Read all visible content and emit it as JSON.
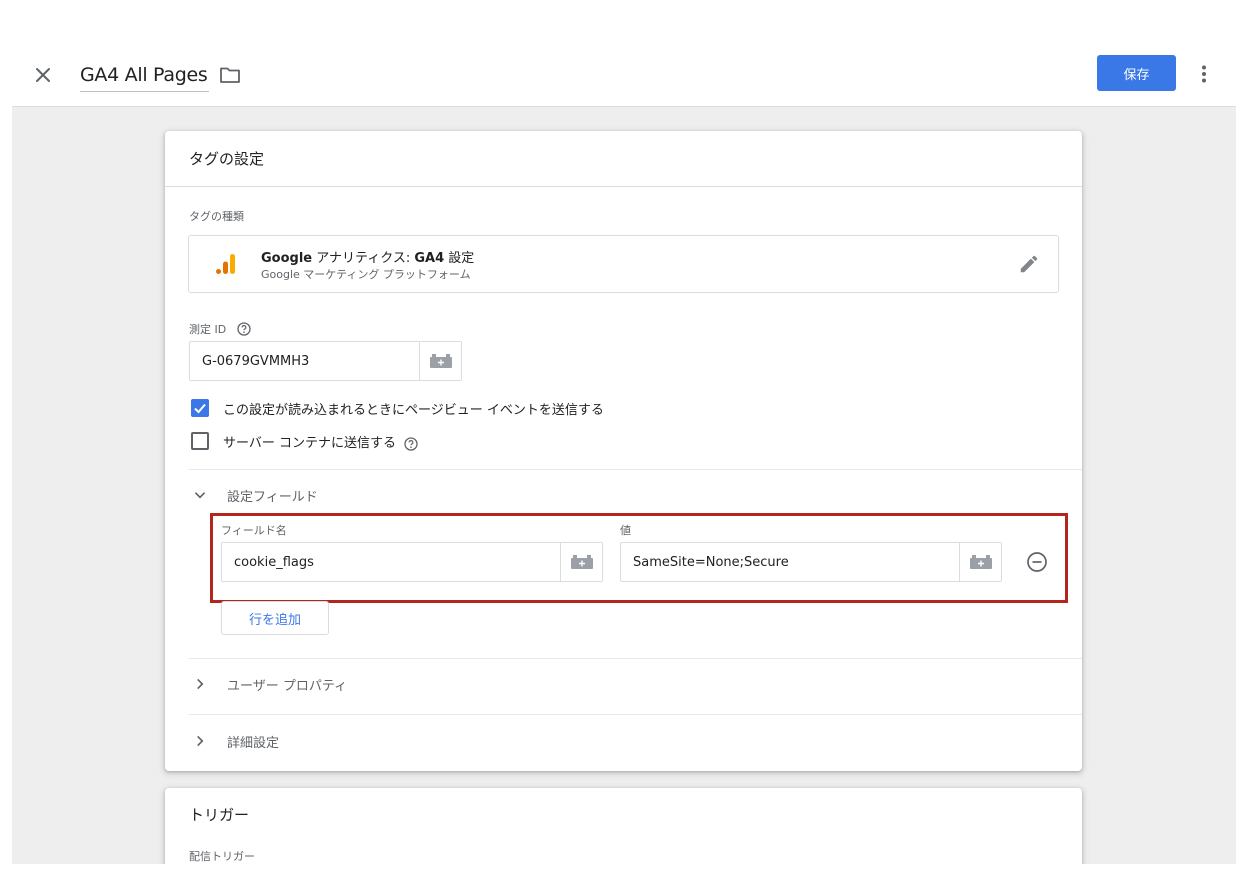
{
  "header": {
    "tag_name": "GA4 All Pages",
    "save_label": "保存"
  },
  "tag_config": {
    "title": "タグの設定",
    "tag_type_label": "タグの種類",
    "tag_type": {
      "name_brand": "Google",
      "name_mid": " アナリティクス: ",
      "name_strong": "GA4",
      "name_end": " 設定",
      "subtitle": "Google マーケティング プラットフォーム"
    },
    "measurement_id_label": "測定 ID",
    "measurement_id_value": "G-0679GVMMH3",
    "send_pageview_label": "この設定が読み込まれるときにページビュー イベントを送信する",
    "send_pageview_checked": true,
    "server_container_label": "サーバー コンテナに送信する",
    "server_container_checked": false,
    "fields_section": {
      "title": "設定フィールド",
      "field_name_header": "フィールド名",
      "value_header": "値",
      "rows": [
        {
          "field_name": "cookie_flags",
          "value": "SameSite=None;Secure"
        }
      ],
      "add_row_label": "行を追加"
    },
    "user_properties_title": "ユーザー プロパティ",
    "advanced_title": "詳細設定"
  },
  "triggers": {
    "title": "トリガー",
    "firing_label": "配信トリガー"
  },
  "colors": {
    "primary": "#3b78e7",
    "highlight": "#b3261e",
    "ga_orange": "#f9ab00",
    "ga_dark_orange": "#e37400"
  }
}
